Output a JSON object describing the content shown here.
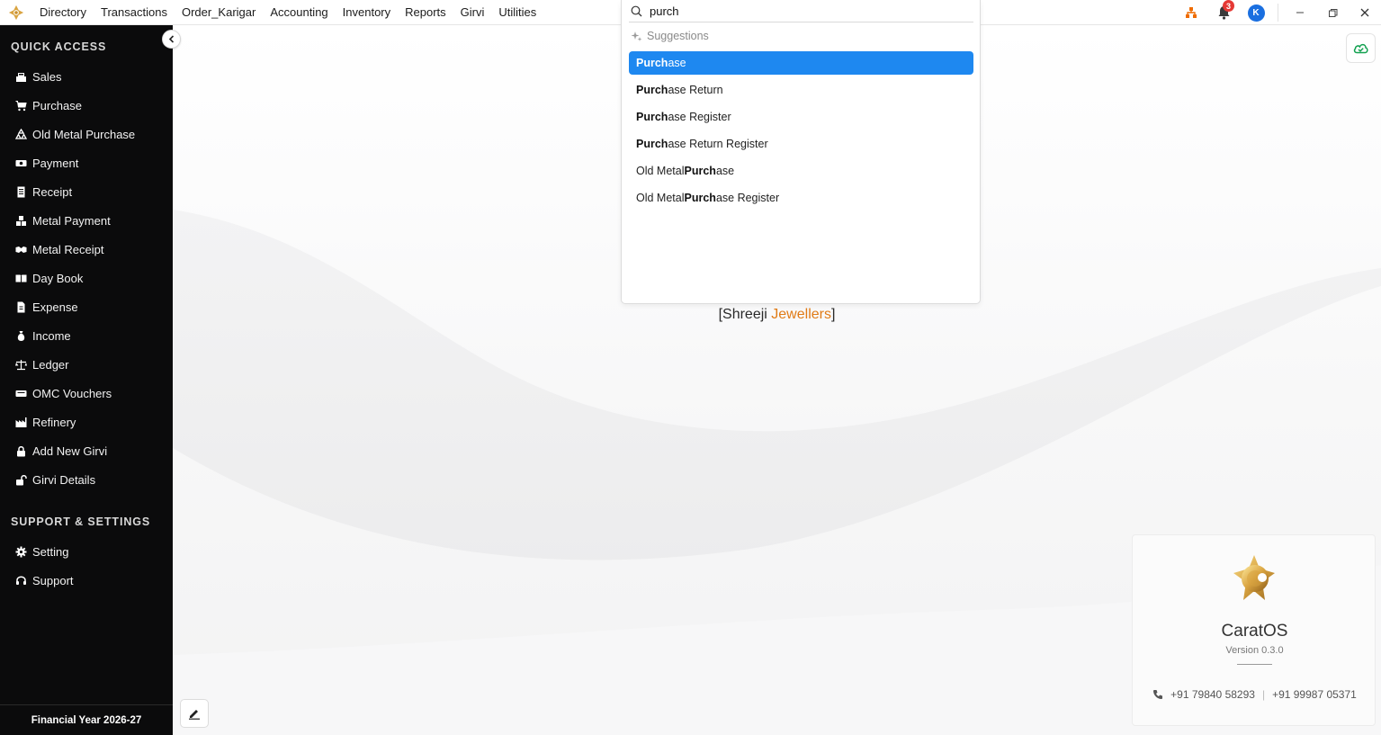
{
  "menu": [
    "Directory",
    "Transactions",
    "Order_Karigar",
    "Accounting",
    "Inventory",
    "Reports",
    "Girvi",
    "Utilities"
  ],
  "notifications_count": "3",
  "avatar_letter": "K",
  "search": {
    "value": "purch",
    "suggestions_title": "Suggestions",
    "suggestions": [
      {
        "pre": "",
        "match": "Purch",
        "post": "ase"
      },
      {
        "pre": "",
        "match": "Purch",
        "post": "ase Return"
      },
      {
        "pre": "",
        "match": "Purch",
        "post": "ase Register"
      },
      {
        "pre": "",
        "match": "Purch",
        "post": "ase Return Register"
      },
      {
        "pre": "Old Metal ",
        "match": "Purch",
        "post": "ase"
      },
      {
        "pre": "Old Metal ",
        "match": "Purch",
        "post": "ase Register"
      }
    ]
  },
  "sidebar": {
    "quick_access_title": "QUICK ACCESS",
    "quick_access": [
      {
        "label": "Sales",
        "icon": "cash-register-icon"
      },
      {
        "label": "Purchase",
        "icon": "cart-icon"
      },
      {
        "label": "Old Metal Purchase",
        "icon": "recycle-icon"
      },
      {
        "label": "Payment",
        "icon": "money-icon"
      },
      {
        "label": "Receipt",
        "icon": "receipt-icon"
      },
      {
        "label": "Metal Payment",
        "icon": "cubes-icon"
      },
      {
        "label": "Metal Receipt",
        "icon": "handshake-icon"
      },
      {
        "label": "Day Book",
        "icon": "book-open-icon"
      },
      {
        "label": "Expense",
        "icon": "invoice-icon"
      },
      {
        "label": "Income",
        "icon": "money-bag-icon"
      },
      {
        "label": "Ledger",
        "icon": "scale-icon"
      },
      {
        "label": "OMC Vouchers",
        "icon": "voucher-icon"
      },
      {
        "label": "Refinery",
        "icon": "industry-icon"
      },
      {
        "label": "Add New Girvi",
        "icon": "lock-icon"
      },
      {
        "label": "Girvi Details",
        "icon": "unlock-icon"
      }
    ],
    "support_title": "SUPPORT & SETTINGS",
    "support": [
      {
        "label": "Setting",
        "icon": "gear-icon"
      },
      {
        "label": "Support",
        "icon": "headset-icon"
      }
    ],
    "financial_year": "Financial Year 2026-27"
  },
  "company": {
    "open": "[Shreeji ",
    "accent": "Jewellers",
    "close": "]"
  },
  "about": {
    "name": "CaratOS",
    "version": "Version 0.3.0",
    "phone1": "+91 79840 58293",
    "phone_sep": "|",
    "phone2": "+91 99987 05371"
  },
  "colors": {
    "accent": "#1e88f0",
    "brand_orange": "#e07b16",
    "sidebar_bg": "#0b0b0c",
    "badge": "#e53935"
  }
}
